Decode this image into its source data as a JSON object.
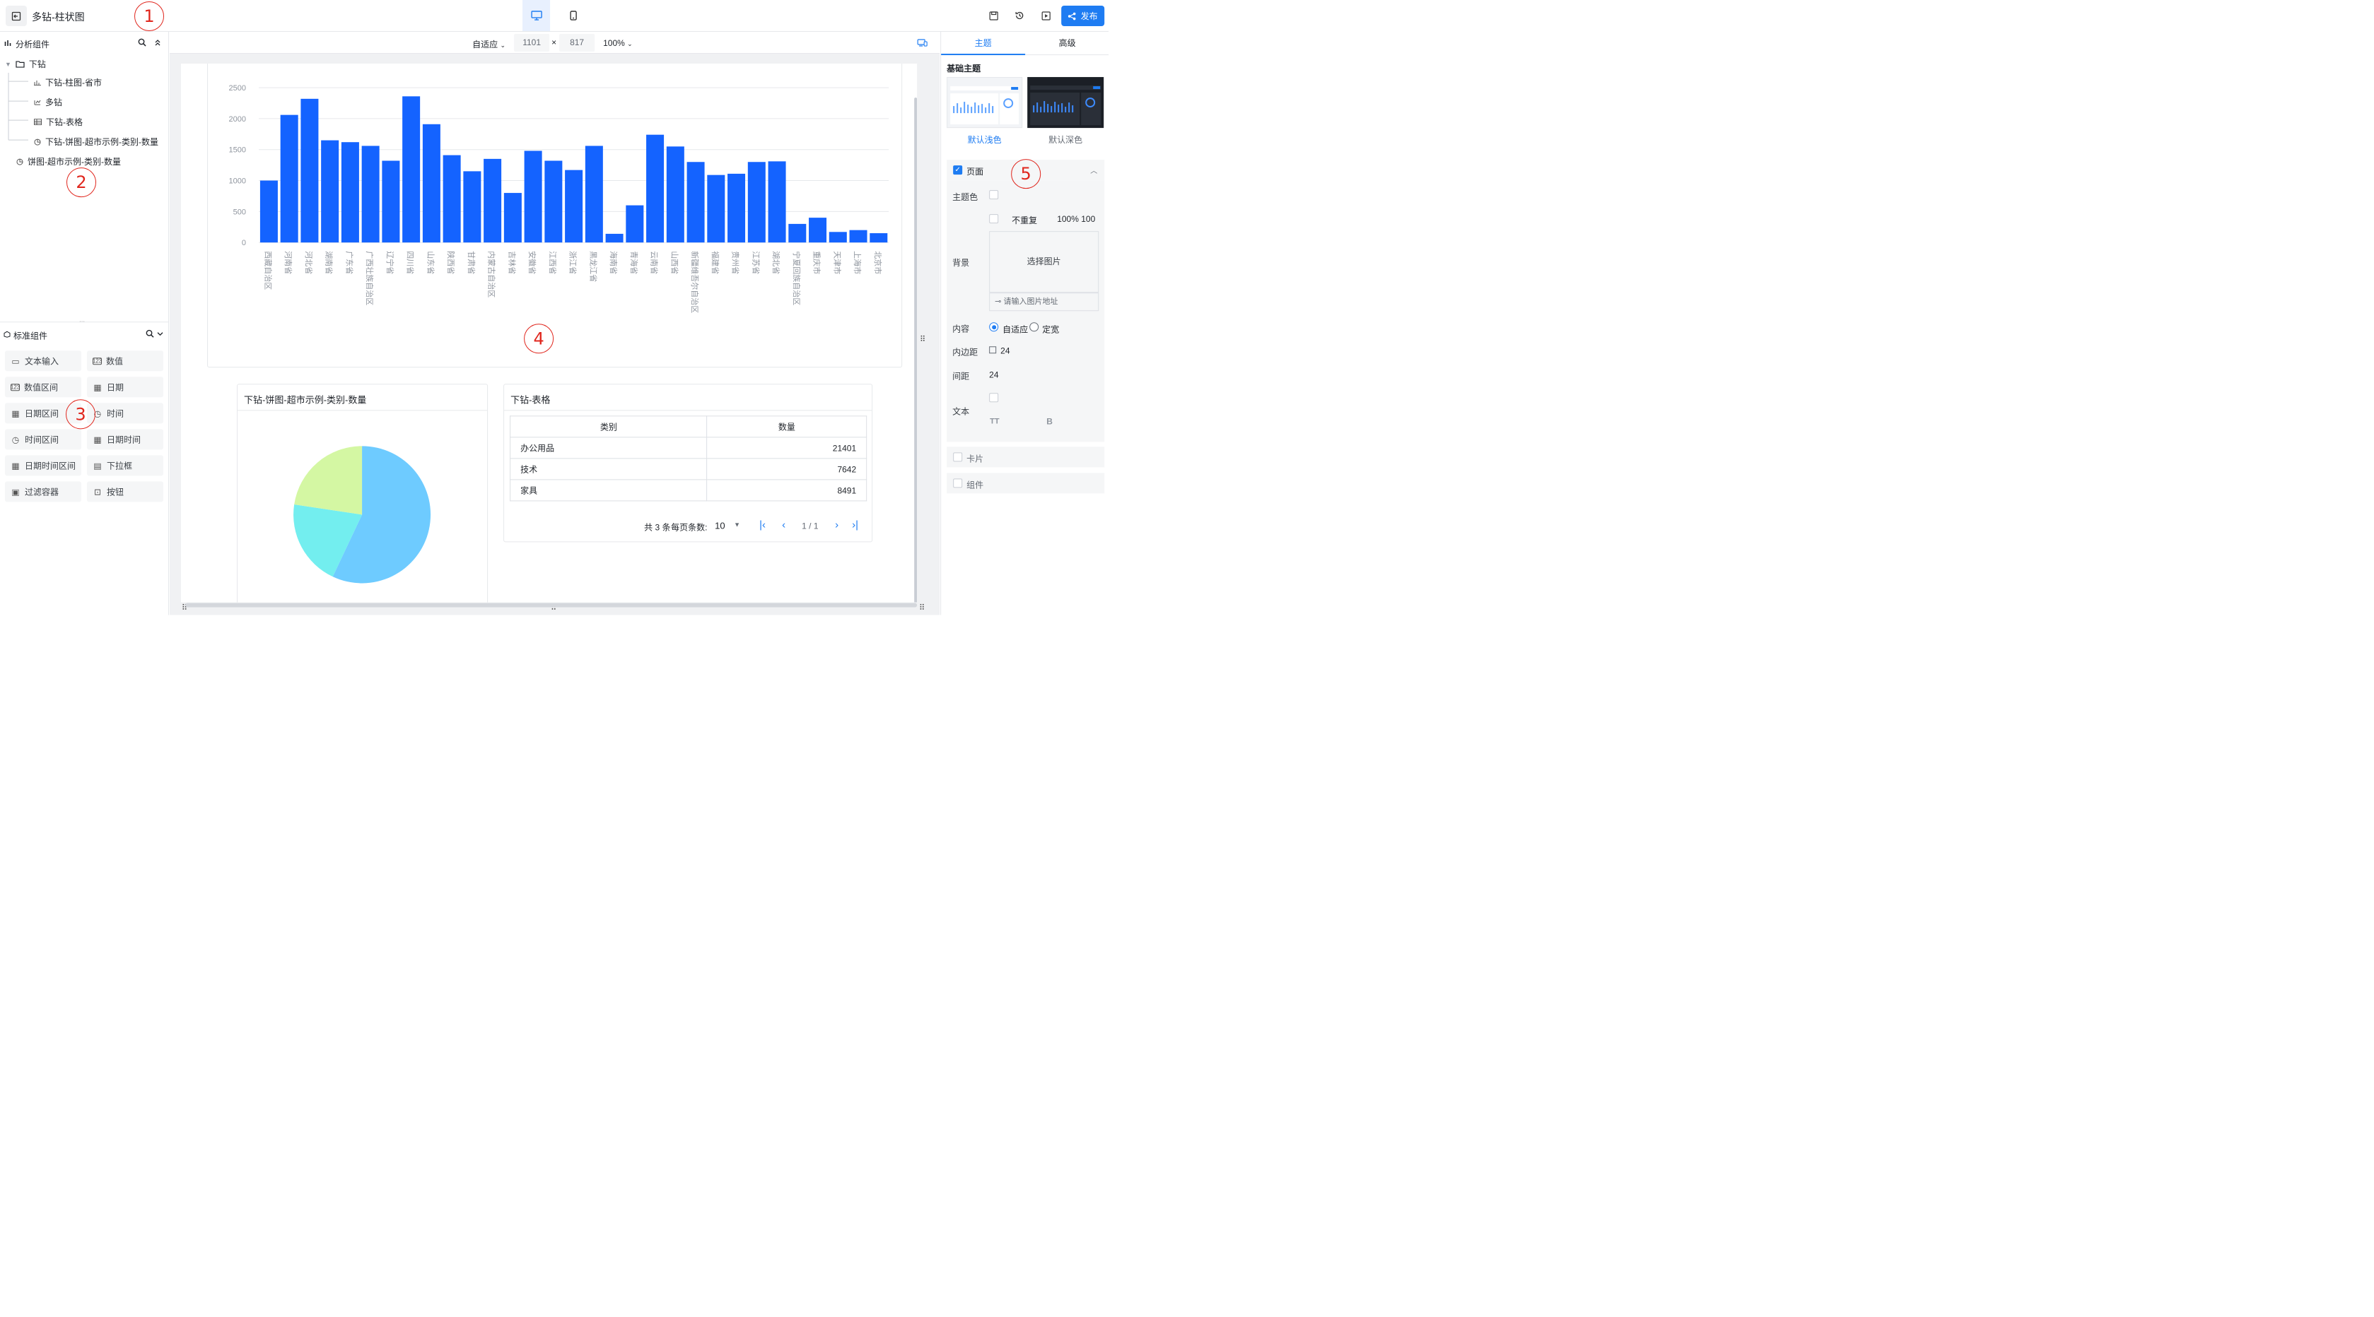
{
  "header": {
    "title": "多钻-柱状图",
    "publish_label": "发布"
  },
  "annotations": [
    "1",
    "2",
    "3",
    "4",
    "5"
  ],
  "left_panel": {
    "analysis_title": "分析组件",
    "tree": [
      {
        "label": "下钻",
        "icon": "folder-icon"
      },
      {
        "label": "下钻-柱图-省市",
        "icon": "bar-chart-icon"
      },
      {
        "label": "多钻",
        "icon": "drill-icon"
      },
      {
        "label": "下钻-表格",
        "icon": "table-icon"
      },
      {
        "label": "下钻-饼图-超市示例-类别-数量",
        "icon": "pie-chart-icon"
      },
      {
        "label": "饼图-超市示例-类别-数量",
        "icon": "pie-chart-icon"
      }
    ],
    "standard_title": "标准组件",
    "standard_items": [
      "文本输入",
      "数值",
      "数值区间",
      "日期",
      "日期区间",
      "时间",
      "时间区间",
      "日期时间",
      "日期时间区间",
      "下拉框",
      "过滤容器",
      "按钮"
    ]
  },
  "canvas_toolbar": {
    "mode": "自适应",
    "width": "1101",
    "times": "×",
    "height": "817",
    "zoom": "100%"
  },
  "pie_card": {
    "title": "下钻-饼图-超市示例-类别-数量"
  },
  "table_card": {
    "title": "下钻-表格",
    "columns": [
      "类别",
      "数量"
    ],
    "rows": [
      [
        "办公用品",
        "21401"
      ],
      [
        "技术",
        "7642"
      ],
      [
        "家具",
        "8491"
      ]
    ],
    "pagination": {
      "total": "共 3 条",
      "per_page_label": "每页条数:",
      "per_page": "10",
      "page": "1 / 1"
    }
  },
  "right_panel": {
    "tabs": [
      "主题",
      "高级"
    ],
    "section_title": "基础主题",
    "themes": [
      "默认浅色",
      "默认深色"
    ],
    "page_section": "页面",
    "theme_color_label": "主题色",
    "no_repeat": "不重复",
    "percent_value": "100% 100",
    "background_label": "背景",
    "select_image": "选择图片",
    "image_url_placeholder": "请输入图片地址",
    "content_label": "内容",
    "content_options": [
      "自适应",
      "定宽"
    ],
    "padding_label": "内边距",
    "padding_value": "24",
    "gap_label": "间距",
    "gap_value": "24",
    "text_label": "文本",
    "text_icons": [
      "TT",
      "B"
    ],
    "card_section": "卡片",
    "component_section": "组件"
  },
  "chart_data": [
    {
      "type": "bar",
      "categories": [
        "西藏自治区",
        "河南省",
        "河北省",
        "湖南省",
        "广东省",
        "广西壮族自治区",
        "辽宁省",
        "四川省",
        "山东省",
        "陕西省",
        "甘肃省",
        "内蒙古自治区",
        "吉林省",
        "安徽省",
        "江西省",
        "浙江省",
        "黑龙江省",
        "海南省",
        "青海省",
        "云南省",
        "山西省",
        "新疆维吾尔自治区",
        "福建省",
        "贵州省",
        "江苏省",
        "湖北省",
        "宁夏回族自治区",
        "重庆市",
        "天津市",
        "上海市",
        "北京市"
      ],
      "values": [
        1000,
        2060,
        2320,
        1650,
        1620,
        1560,
        1320,
        2360,
        1910,
        1410,
        1150,
        1350,
        800,
        1480,
        1320,
        1170,
        1560,
        140,
        600,
        1740,
        1550,
        1300,
        1090,
        1110,
        1300,
        1310,
        300,
        400,
        170,
        200,
        150
      ],
      "ylim": [
        0,
        2500
      ],
      "yticks": [
        0,
        500,
        1000,
        1500,
        2000,
        2500
      ],
      "color": "#1463ff",
      "grid": true
    },
    {
      "type": "pie",
      "labels": [
        "办公用品",
        "技术",
        "家具"
      ],
      "values": [
        21401,
        7642,
        8491
      ],
      "colors": [
        "#6ecbff",
        "#73eeef",
        "#d4f7a3"
      ]
    }
  ]
}
